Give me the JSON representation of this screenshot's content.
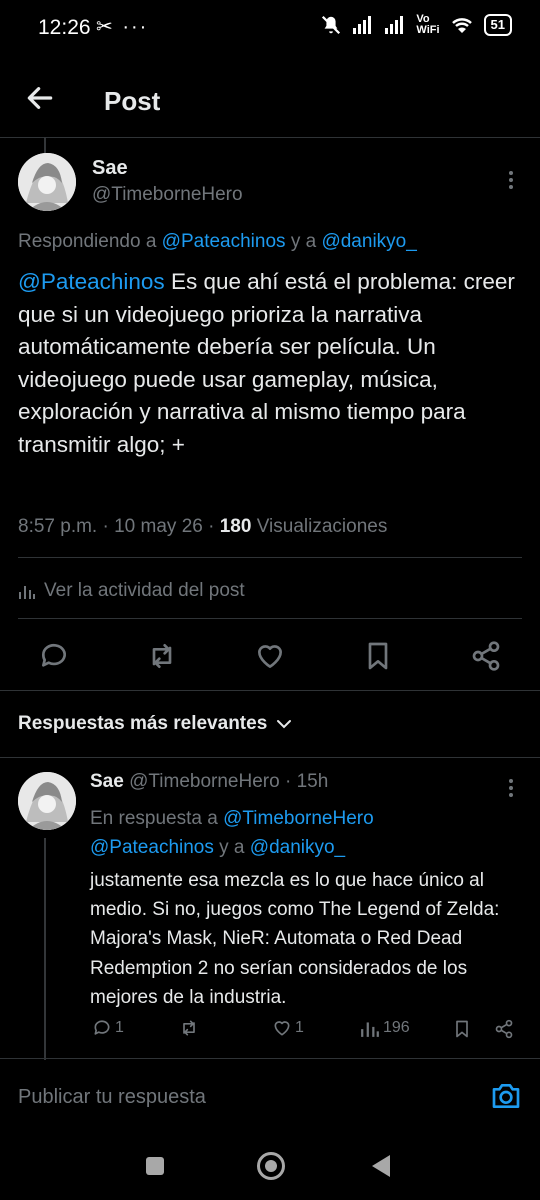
{
  "status_bar": {
    "time": "12:26",
    "misc_icons": "✂ ···",
    "vowifi_top": "Vo",
    "vowifi_bottom": "WiFi",
    "battery": "51"
  },
  "header": {
    "title": "Post"
  },
  "post": {
    "author_name": "Sae",
    "author_handle": "@TimeborneHero",
    "replying_prefix": "Respondiendo a ",
    "replying_user1": "@Pateachinos",
    "replying_and": " y a ",
    "replying_user2": "@danikyo_",
    "mention": "@Pateachinos",
    "text": " Es que ahí está el problema: creer que si un videojuego prioriza la narrativa automáticamente debería ser película. Un videojuego puede usar gameplay, música, exploración y narrativa al mismo tiempo para transmitir algo; +",
    "time": "8:57 p.m.",
    "date": "10 may 26",
    "views_count": "180",
    "views_label": "Visualizaciones",
    "activity_label": "Ver la actividad del post"
  },
  "sort": {
    "label": "Respuestas más relevantes"
  },
  "reply": {
    "author_name": "Sae",
    "author_handle": "@TimeborneHero",
    "age": "15h",
    "in_reply_prefix": "En respuesta a ",
    "in_reply_user1": "@TimeborneHero",
    "in_reply_user2": "@Pateachinos",
    "in_reply_and": " y a ",
    "in_reply_user3": "@danikyo_",
    "text": "justamente esa mezcla es lo que hace único al medio. Si no, juegos como The Legend of Zelda: Majora's Mask, NieR: Automata o Red Dead Redemption 2 no serían considerados de los mejores de la industria.",
    "reply_count": "1",
    "like_count": "1",
    "view_count": "196"
  },
  "compose": {
    "placeholder": "Publicar tu respuesta"
  },
  "colors": {
    "accent": "#1d9bf0",
    "muted": "#71767b",
    "text": "#e7e9ea",
    "background": "#000000",
    "divider": "#2f3336"
  }
}
